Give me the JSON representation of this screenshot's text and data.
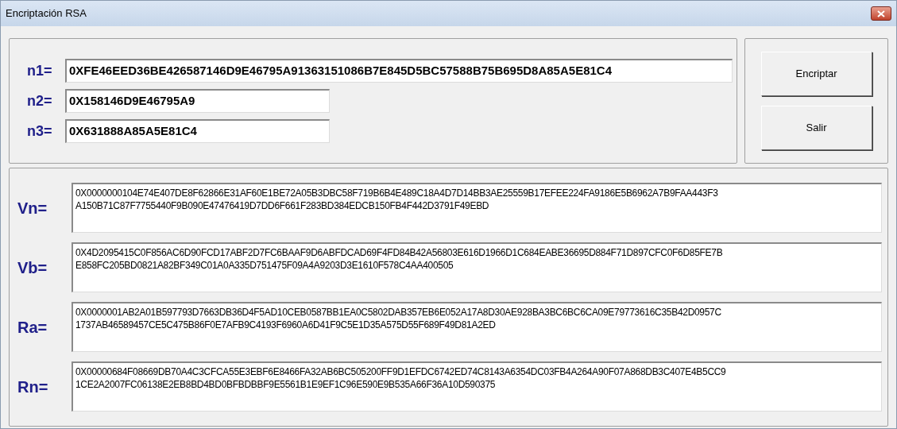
{
  "window": {
    "title": "Encriptación RSA"
  },
  "inputs": [
    {
      "label": "n1=",
      "value": "0XFE46EED36BE426587146D9E46795A91363151086B7E845D5BC57588B75B695D8A85A5E81C4",
      "kind": "wide"
    },
    {
      "label": "n2=",
      "value": "0X158146D9E46795A9",
      "kind": "short"
    },
    {
      "label": "n3=",
      "value": "0X631888A85A5E81C4",
      "kind": "short"
    }
  ],
  "buttons": [
    "Encriptar",
    "Salir"
  ],
  "outputs": [
    {
      "label": "Vn=",
      "lines": [
        "0X0000000104E74E407DE8F62866E31AF60E1BE72A05B3DBC58F719B6B4E489C18A4D7D14BB3AE25559B17EFEE224FA9186E5B6962A7B9FAA443F3",
        "A150B71C87F7755440F9B090E47476419D7DD6F661F283BD384EDCB150FB4F442D3791F49EBD"
      ]
    },
    {
      "label": "Vb=",
      "lines": [
        "0X4D2095415C0F856AC6D90FCD17ABF2D7FC6BAAF9D6ABFDCAD69F4FD84B42A56803E616D1966D1C684EABE36695D884F71D897CFC0F6D85FE7B",
        "E858FC205BD0821A82BF349C01A0A335D751475F09A4A9203D3E1610F578C4AA400505"
      ]
    },
    {
      "label": "Ra=",
      "lines": [
        "0X0000001AB2A01B597793D7663DB36D4F5AD10CEB0587BB1EA0C5802DAB357EB6E052A17A8D30AE928BA3BC6BC6CA09E79773616C35B42D0957C",
        "1737AB46589457CE5C475B86F0E7AFB9C4193F6960A6D41F9C5E1D35A575D55F689F49D81A2ED"
      ]
    },
    {
      "label": "Rn=",
      "lines": [
        "0X00000684F08669DB70A4C3CFCA55E3EBF6E8466FA32AB6BC505200FF9D1EFDC6742ED74C8143A6354DC03FB4A264A90F07A868DB3C407E4B5CC9",
        "1CE2A2007FC06138E2EB8BD4BD0BFBDBBF9E5561B1E9EF1C96E590E9B535A66F36A10D590375"
      ]
    }
  ]
}
